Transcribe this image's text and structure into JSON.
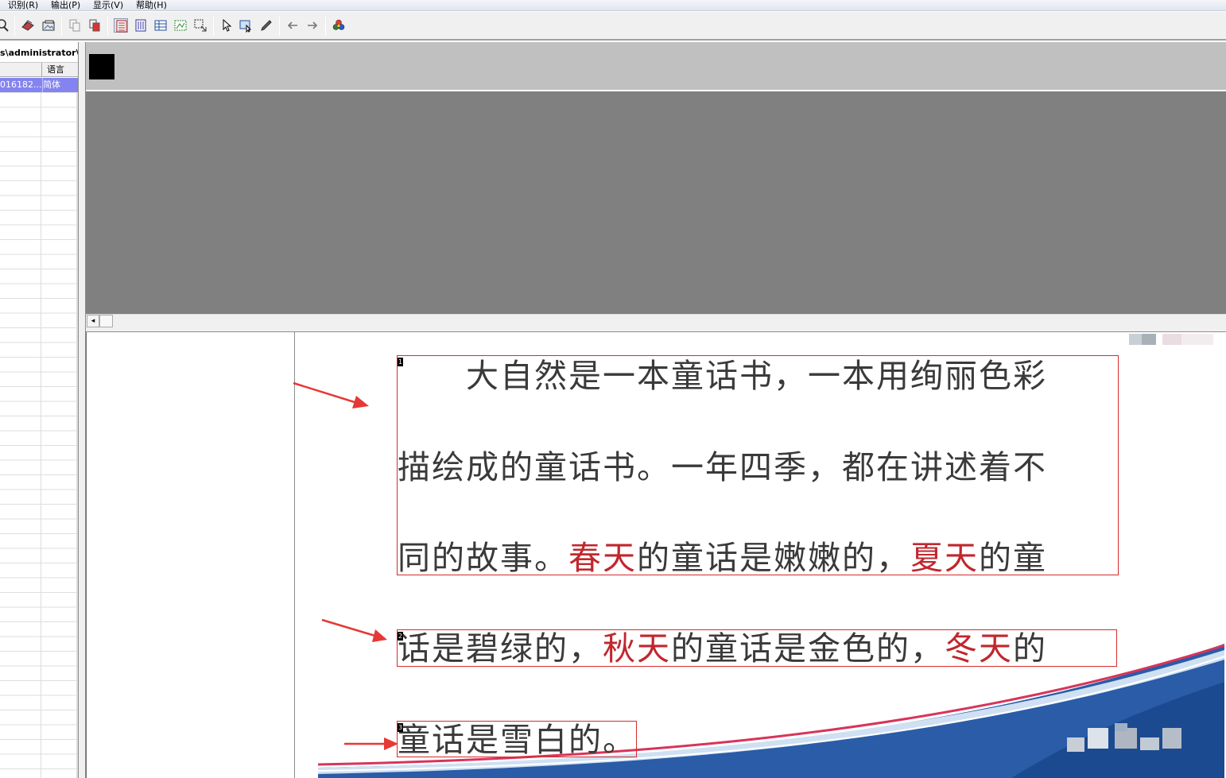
{
  "menu": {
    "items": [
      {
        "label": "识别(R)"
      },
      {
        "label": "输出(P)"
      },
      {
        "label": "显示(V)"
      },
      {
        "label": "帮助(H)"
      }
    ]
  },
  "toolbar": {
    "icons": [
      "zoom-icon",
      "scan-icon",
      "open-image-icon",
      "copy-icon",
      "delete-page-icon",
      "text-region-icon",
      "vertical-text-icon",
      "table-region-icon",
      "image-region-icon",
      "select-region-icon",
      "pointer-icon",
      "recognize-icon",
      "pencil-icon",
      "back-arrow-icon",
      "forward-arrow-icon",
      "color-wheel-icon"
    ]
  },
  "left_panel": {
    "path": "s\\administrator\\",
    "column_language": "语言",
    "rows": [
      {
        "name": "016182...",
        "language": "简体"
      }
    ]
  },
  "document": {
    "lines": [
      [
        {
          "t": "　　大自然是一本童话书，一本用绚丽色彩"
        }
      ],
      [
        {
          "t": "描绘成的童话书。一年四季，都在讲述着不"
        }
      ],
      [
        {
          "t": "同的故事。"
        },
        {
          "t": "春天",
          "red": true
        },
        {
          "t": "的童话是嫩嫩的，"
        },
        {
          "t": "夏天",
          "red": true
        },
        {
          "t": "的童"
        }
      ],
      [
        {
          "t": "话是碧绿的，"
        },
        {
          "t": "秋天",
          "red": true
        },
        {
          "t": "的童话是金色的，"
        },
        {
          "t": "冬天",
          "red": true
        },
        {
          "t": "的"
        }
      ],
      [
        {
          "t": "童话是雪白的。"
        }
      ]
    ],
    "regions": [
      "1",
      "2",
      "3"
    ]
  },
  "colors": {
    "region_border": "#d62b2b",
    "highlight_red": "#c0272d",
    "selection": "#8484f0",
    "annotation_arrow": "#e53935"
  }
}
